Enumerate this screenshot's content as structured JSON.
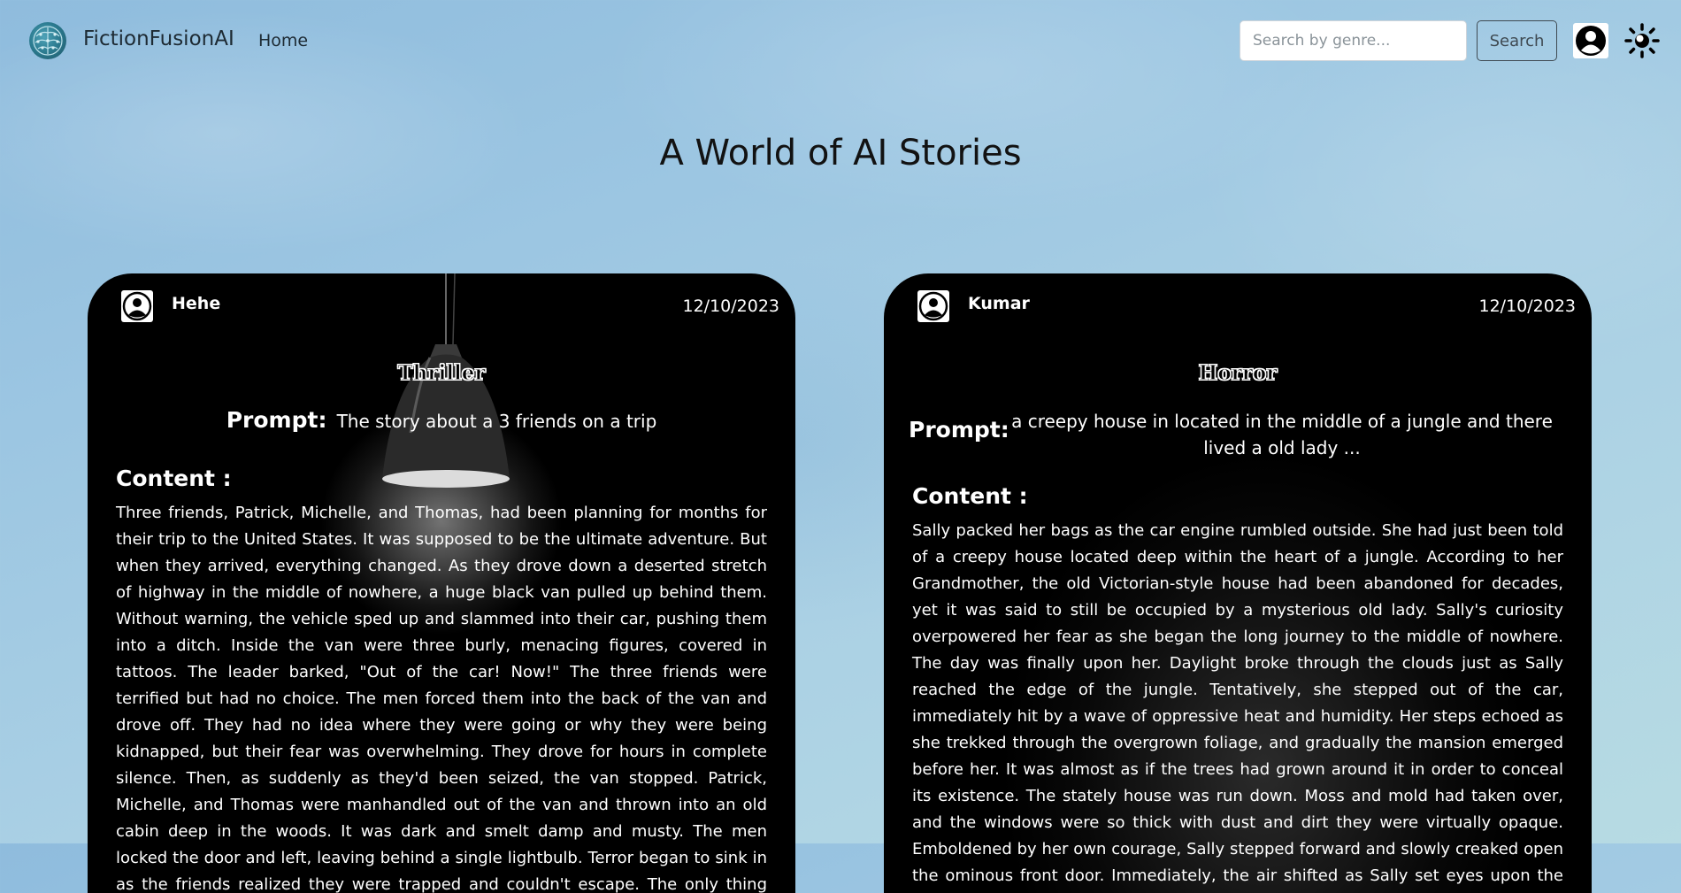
{
  "navbar": {
    "brand": "FictionFusionAI",
    "home_label": "Home",
    "search_placeholder": "Search by genre...",
    "search_value": "",
    "search_button": "Search",
    "avatar_icon": "user-circle-icon",
    "theme_icon": "sun-icon"
  },
  "main": {
    "title": "A World of AI Stories"
  },
  "stories": [
    {
      "author": "Hehe",
      "date": "12/10/2023",
      "genre": "Thriller",
      "prompt_label": "Prompt:",
      "prompt": "The story about a 3 friends on a trip",
      "content_label": "Content :",
      "content": "Three friends, Patrick, Michelle, and Thomas, had been planning for months for their trip to the United States. It was supposed to be the ultimate adventure. But when they arrived, everything changed. As they drove down a deserted stretch of highway in the middle of nowhere, a huge black van pulled up behind them. Without warning, the vehicle sped up and slammed into their car, pushing them into a ditch. Inside the van were three burly, menacing figures, covered in tattoos. The leader barked, \"Out of the car! Now!\" The three friends were terrified but had no choice. The men forced them into the back of the van and drove off. They had no idea where they were going or why they were being kidnapped, but their fear was overwhelming. They drove for hours in complete silence. Then, as suddenly as they'd been seized, the van stopped. Patrick, Michelle, and Thomas were manhandled out of the van and thrown into an old cabin deep in the woods. It was dark and smelt damp and musty. The men locked the door and left, leaving behind a single lightbulb. Terror began to sink in as the friends realized they were trapped and couldn't escape. The only thing they had to keep them company was an old"
    },
    {
      "author": "Kumar",
      "date": "12/10/2023",
      "genre": "Horror",
      "prompt_label": "Prompt:",
      "prompt": "a creepy house in located in the middle of a jungle and there lived a old lady ...",
      "content_label": "Content :",
      "content": "Sally packed her bags as the car engine rumbled outside. She had just been told of a creepy house located deep within the heart of a jungle. According to her Grandmother, the old Victorian-style house had been abandoned for decades, yet it was said to still be occupied by a mysterious old lady. Sally's curiosity overpowered her fear as she began the long journey to the middle of nowhere. The day was finally upon her. Daylight broke through the clouds just as Sally reached the edge of the jungle. Tentatively, she stepped out of the car, immediately hit by a wave of oppressive heat and humidity. Her steps echoed as she trekked through the overgrown foliage, and gradually the mansion emerged before her. It was almost as if the trees had grown around it in order to conceal its existence. The stately house was run down. Moss and mold had taken over, and the windows were so thick with dust and dirt they were virtually opaque. Emboldened by her own courage, Sally stepped forward and slowly creaked open the ominous front door. Immediately, the air shifted as Sally set eyes upon the old woman who sat"
    }
  ]
}
